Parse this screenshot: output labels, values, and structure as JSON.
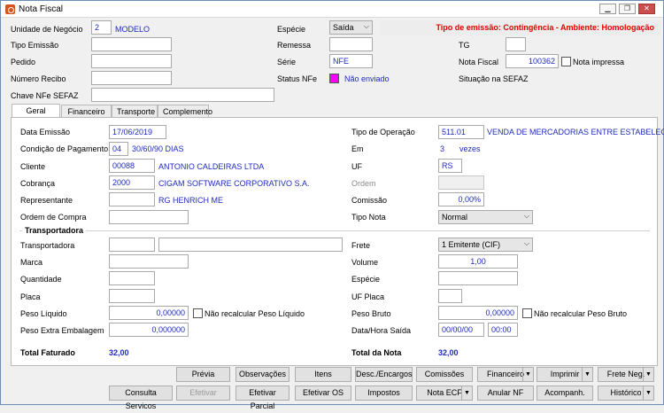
{
  "window": {
    "title": "Nota Fiscal"
  },
  "header": {
    "unidade_label": "Unidade de Negócio",
    "unidade_code": "2",
    "unidade_name": "MODELO",
    "especie_label": "Espécie",
    "especie_value": "Saída",
    "emissao_banner": "Tipo de emissão: Contingência - Ambiente: Homologação",
    "tipo_emissao_label": "Tipo Emissão",
    "remessa_label": "Remessa",
    "tg_label": "TG",
    "pedido_label": "Pedido",
    "serie_label": "Série",
    "serie_value": "NFE",
    "nota_fiscal_label": "Nota Fiscal",
    "nota_fiscal_value": "100362",
    "nota_impressa_label": "Nota impressa",
    "numero_recibo_label": "Número Recibo",
    "status_nfe_label": "Status NFe",
    "status_nfe_value": "Não enviado",
    "situacao_sefaz_label": "Situação na SEFAZ",
    "chave_label": "Chave NFe SEFAZ"
  },
  "tabs": [
    "Geral",
    "Financeiro",
    "Transporte",
    "Complemento"
  ],
  "geral": {
    "data_emissao_label": "Data Emissão",
    "data_emissao_value": "17/06/2019",
    "tipo_operacao_label": "Tipo de Operação",
    "tipo_operacao_code": "511.01",
    "tipo_operacao_desc": "VENDA DE MERCADORIAS ENTRE ESTABELECIMEN",
    "condicao_label": "Condição de Pagamento",
    "condicao_code": "04",
    "condicao_desc": "30/60/90 DIAS",
    "em_label": "Em",
    "em_value": "3",
    "vezes_label": "vezes",
    "cliente_label": "Cliente",
    "cliente_code": "00088",
    "cliente_name": "ANTONIO CALDEIRAS LTDA",
    "uf_label": "UF",
    "uf_value": "RS",
    "cobranca_label": "Cobrança",
    "cobranca_code": "2000",
    "cobranca_name": "CIGAM SOFTWARE CORPORATIVO S.A.",
    "ordem_label": "Ordem",
    "representante_label": "Representante",
    "representante_name": "RG HENRICH ME",
    "comissao_label": "Comissão",
    "comissao_value": "0,00%",
    "ordem_compra_label": "Ordem de Compra",
    "tipo_nota_label": "Tipo Nota",
    "tipo_nota_value": "Normal"
  },
  "transportadora": {
    "group_title": "Transportadora",
    "transportadora_label": "Transportadora",
    "frete_label": "Frete",
    "frete_value": "1 Emitente (CIF)",
    "marca_label": "Marca",
    "volume_label": "Volume",
    "volume_value": "1,00",
    "quantidade_label": "Quantidade",
    "especie_label": "Espécie",
    "placa_label": "Placa",
    "uf_placa_label": "UF Placa",
    "peso_liquido_label": "Peso Líquido",
    "peso_liquido_value": "0,00000",
    "nao_recalc_liq": "Não recalcular Peso Líquido",
    "peso_bruto_label": "Peso Bruto",
    "peso_bruto_value": "0,00000",
    "nao_recalc_bruto": "Não recalcular Peso Bruto",
    "peso_extra_label": "Peso Extra Embalagem",
    "peso_extra_value": "0,000000",
    "data_hora_label": "Data/Hora Saída",
    "data_saida_value": "00/00/00",
    "hora_saida_value": "00:00"
  },
  "totals": {
    "faturado_label": "Total Faturado",
    "faturado_value": "32,00",
    "nota_label": "Total da Nota",
    "nota_value": "32,00"
  },
  "buttons": {
    "previa": "Prévia",
    "observacoes": "Observações",
    "itens": "Itens",
    "desc_encargos": "Desc./Encargos",
    "comissoes": "Comissões",
    "financeiro": "Financeiro",
    "imprimir": "Imprimir",
    "frete_neg": "Frete Neg.",
    "consulta_servicos": "Consulta Servicos",
    "efetivar": "Efetivar",
    "efetivar_parcial": "Efetivar Parcial",
    "efetivar_os": "Efetivar OS",
    "impostos": "Impostos",
    "nota_ecf": "Nota ECF",
    "anular_nf": "Anular NF",
    "acompanh": "Acompanh.",
    "historico": "Histórico"
  }
}
